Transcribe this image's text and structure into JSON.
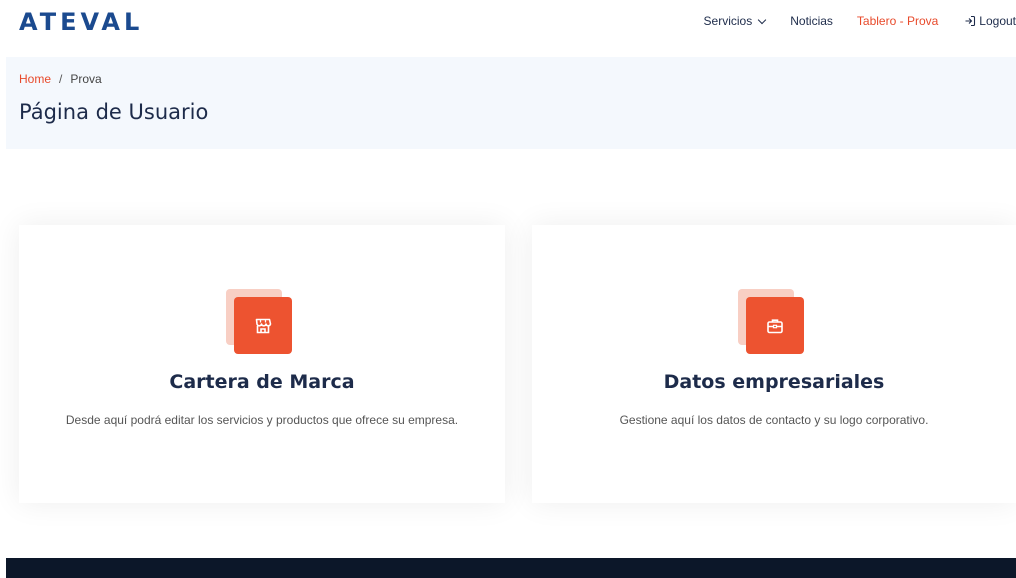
{
  "header": {
    "logo": "ATEVAL",
    "nav": {
      "services": "Servicios",
      "news": "Noticias",
      "board": "Tablero - Prova",
      "logout": "Logout"
    }
  },
  "breadcrumb": {
    "home": "Home",
    "separator": "/",
    "current": "Prova"
  },
  "page": {
    "title": "Página de Usuario"
  },
  "cards": [
    {
      "icon": "storefront-icon",
      "title": "Cartera de Marca",
      "description": "Desde aquí podrá editar los servicios y productos que ofrece su empresa."
    },
    {
      "icon": "briefcase-icon",
      "title": "Datos empresariales",
      "description": "Gestione aquí los datos de contacto y su logo corporativo."
    }
  ],
  "colors": {
    "accent": "#ed5330",
    "accent_light": "#f8cfc4",
    "brand": "#1b4a8f",
    "heading": "#1d2b4a",
    "band": "#f4f8fd",
    "footer": "#0c1729"
  }
}
